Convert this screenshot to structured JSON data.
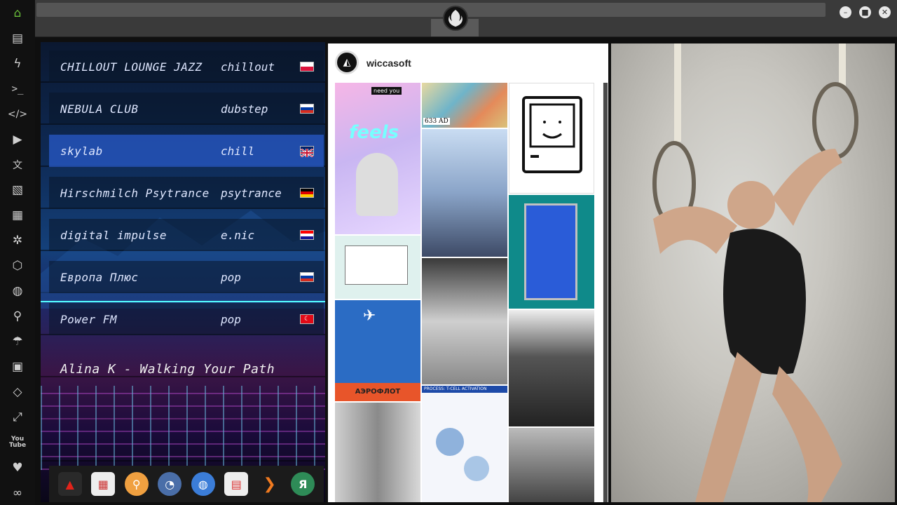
{
  "sidebar": {
    "icons": [
      "home-icon",
      "document-icon",
      "lightning-icon",
      "terminal-icon",
      "code-icon",
      "play-icon",
      "translate-icon",
      "image-icon",
      "news-icon",
      "settings-icon",
      "hexagon-icon",
      "globe-icon",
      "search-icon",
      "umbrella-icon",
      "contact-icon",
      "code-bracket-icon",
      "fullscreen-icon",
      "youtube-icon",
      "heart-icon",
      "cloud-icon"
    ],
    "youtube_label": "You Tube"
  },
  "radio": {
    "stations": [
      {
        "name": "CHILLOUT LOUNGE JAZZ",
        "genre": "chillout",
        "flag": "poland-flag"
      },
      {
        "name": "NEBULA CLUB",
        "genre": "dubstep",
        "flag": "russia-flag"
      },
      {
        "name": "skylab",
        "genre": "chill",
        "flag": "uk-flag"
      },
      {
        "name": "Hirschmilch Psytrance",
        "genre": "psytrance",
        "flag": "germany-flag"
      },
      {
        "name": "digital impulse",
        "genre": "e.nic",
        "flag": "croatia-flag"
      },
      {
        "name": "Европа Плюс",
        "genre": "pop",
        "flag": "russia-flag"
      },
      {
        "name": "Power FM",
        "genre": "pop",
        "flag": "turkey-flag"
      }
    ],
    "selected_index": 2,
    "now_playing": "Alina K - Walking Your Path"
  },
  "dock": {
    "apps": [
      "arch-app-icon",
      "calendar-news-app-icon",
      "magnifier-app-icon",
      "clock-app-icon",
      "globe-app-icon",
      "calendar-app-icon",
      "arrow-app-icon",
      "yandex-app-icon"
    ],
    "yandex_letter": "Я"
  },
  "instagram": {
    "username": "wiccasoft",
    "tiles": [
      {
        "caption": "need you",
        "text2": "feels"
      },
      {
        "caption": "633 AD"
      },
      {
        "caption": "АЭРОФЛОТ"
      },
      {
        "caption": "PROCESS: T-CELL ACTIVATION"
      }
    ]
  },
  "colors": {
    "accent_selected": "#2f5fc8",
    "sidebar_home": "#6abf3a"
  }
}
